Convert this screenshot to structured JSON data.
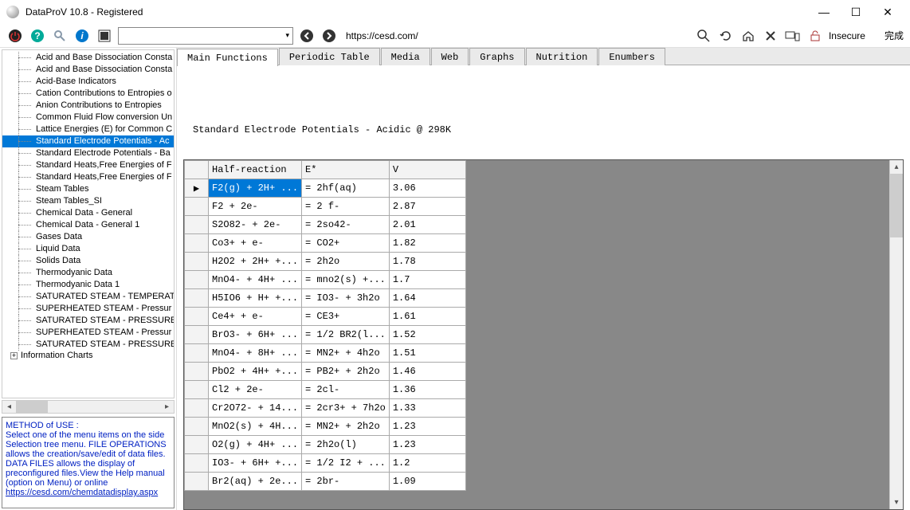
{
  "window": {
    "title": "DataProV 10.8 - Registered"
  },
  "toolbar": {
    "url": "https://cesd.com/",
    "insecure": "Insecure",
    "done": "完成"
  },
  "tree": {
    "items": [
      "Acid and Base Dissociation Consta",
      "Acid and Base Dissociation Consta",
      "Acid-Base Indicators",
      "Cation Contributions to Entropies o",
      "Anion Contributions to Entropies",
      "Common Fluid Flow conversion Un",
      "Lattice Energies (E) for Common C",
      "Standard Electrode Potentials - Ac",
      "Standard Electrode Potentials - Ba",
      "Standard Heats,Free Energies of F",
      "Standard Heats,Free Energies of F",
      "Steam Tables",
      "Steam Tables_SI",
      "Chemical Data - General",
      "Chemical Data - General 1",
      "Gases Data",
      "Liquid Data",
      "Solids Data",
      "Thermodyanic Data",
      "Thermodyanic Data 1",
      "SATURATED STEAM - TEMPERAT",
      "SUPERHEATED STEAM - Pressur",
      "SATURATED STEAM - PRESSURE",
      "SUPERHEATED STEAM - Pressur",
      "SATURATED STEAM - PRESSURE"
    ],
    "selectedIndex": 7,
    "rootLabel": "Information Charts"
  },
  "help": {
    "title": "METHOD of USE :",
    "body": "Select one of the menu items on the side Selection tree menu. FILE OPERATIONS allows the creation/save/edit of data files. DATA FILES allows the display of preconfigured files.View the Help manual (option on Menu) or online",
    "link": "https://cesd.com/chemdatadisplay.aspx"
  },
  "tabs": [
    "Main Functions",
    "Periodic Table",
    "Media",
    "Web",
    "Graphs",
    "Nutrition",
    "Enumbers"
  ],
  "activeTab": 0,
  "panel": {
    "title": "Standard Electrode Potentials - Acidic @ 298K"
  },
  "grid": {
    "cols": [
      "",
      "Half-reaction",
      "E*",
      "V"
    ],
    "rows": [
      {
        "h": "▶",
        "c": [
          "F2(g) + 2H+ ...",
          "= 2hf(aq)",
          "3.06"
        ],
        "sel": true
      },
      {
        "h": "",
        "c": [
          "F2 + 2e-",
          "= 2 f-",
          "2.87"
        ]
      },
      {
        "h": "",
        "c": [
          "S2O82- + 2e-",
          "= 2so42-",
          "2.01"
        ]
      },
      {
        "h": "",
        "c": [
          "Co3+ + e-",
          "= CO2+",
          "1.82"
        ]
      },
      {
        "h": "",
        "c": [
          "H2O2 + 2H+ +...",
          "= 2h2o",
          "1.78"
        ]
      },
      {
        "h": "",
        "c": [
          "MnO4- + 4H+ ...",
          "= mno2(s) +...",
          "1.7"
        ]
      },
      {
        "h": "",
        "c": [
          "H5IO6 + H+ +...",
          "= IO3- + 3h2o",
          "1.64"
        ]
      },
      {
        "h": "",
        "c": [
          "Ce4+ + e-",
          "= CE3+",
          "1.61"
        ]
      },
      {
        "h": "",
        "c": [
          "BrO3- + 6H+ ...",
          "= 1/2 BR2(l...",
          "1.52"
        ]
      },
      {
        "h": "",
        "c": [
          "MnO4- + 8H+ ...",
          "= MN2+ + 4h2o",
          "1.51"
        ]
      },
      {
        "h": "",
        "c": [
          "PbO2 + 4H+ +...",
          "= PB2+ + 2h2o",
          "1.46"
        ]
      },
      {
        "h": "",
        "c": [
          "Cl2 + 2e-",
          "= 2cl-",
          "1.36"
        ]
      },
      {
        "h": "",
        "c": [
          "Cr2O72- + 14...",
          "= 2cr3+ + 7h2o",
          "1.33"
        ]
      },
      {
        "h": "",
        "c": [
          "MnO2(s) + 4H...",
          "= MN2+ + 2h2o",
          "1.23"
        ]
      },
      {
        "h": "",
        "c": [
          "O2(g) + 4H+ ...",
          "= 2h2o(l)",
          "1.23"
        ]
      },
      {
        "h": "",
        "c": [
          "IO3- + 6H+ +...",
          "= 1/2 I2 + ...",
          "1.2"
        ]
      },
      {
        "h": "",
        "c": [
          "Br2(aq) + 2e...",
          "= 2br-",
          "1.09"
        ]
      }
    ]
  }
}
